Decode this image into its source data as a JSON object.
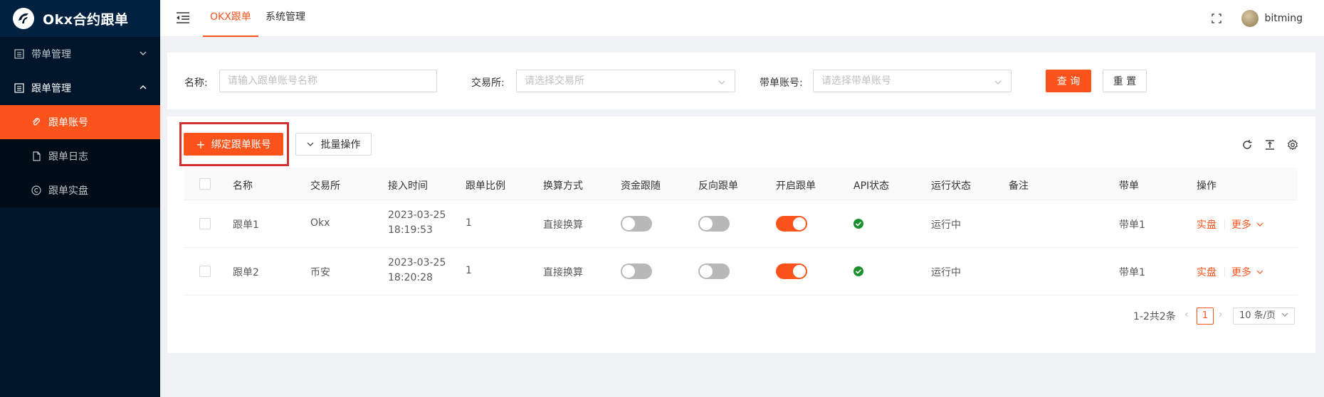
{
  "app": {
    "title": "Okx合约跟单"
  },
  "sidebar": {
    "groups": [
      {
        "label": "带单管理",
        "icon": "list-icon",
        "open": false
      },
      {
        "label": "跟单管理",
        "icon": "list-icon",
        "open": true
      }
    ],
    "items": [
      {
        "label": "跟单账号",
        "icon": "link-icon",
        "active": true
      },
      {
        "label": "跟单日志",
        "icon": "file-icon",
        "active": false
      },
      {
        "label": "跟单实盘",
        "icon": "copyright-icon",
        "active": false
      }
    ]
  },
  "header": {
    "tabs": [
      {
        "label": "OKX跟单",
        "active": true
      },
      {
        "label": "系统管理",
        "active": false
      }
    ],
    "username": "bitming"
  },
  "search": {
    "name_label": "名称:",
    "name_placeholder": "请输入跟单账号名称",
    "exchange_label": "交易所:",
    "exchange_placeholder": "请选择交易所",
    "lead_label": "带单账号:",
    "lead_placeholder": "请选择带单账号",
    "query_label": "查 询",
    "reset_label": "重 置"
  },
  "toolbar": {
    "bind_label": "绑定跟单账号",
    "batch_label": "批量操作"
  },
  "table": {
    "columns": [
      "名称",
      "交易所",
      "接入时间",
      "跟单比例",
      "换算方式",
      "资金跟随",
      "反向跟单",
      "开启跟单",
      "API状态",
      "运行状态",
      "备注",
      "带单",
      "操作"
    ],
    "rows": [
      {
        "name": "跟单1",
        "exchange": "Okx",
        "date": "2023-03-25",
        "time": "18:19:53",
        "ratio": "1",
        "method": "直接换算",
        "fund_follow": false,
        "reverse": false,
        "enabled": true,
        "api_ok": true,
        "status": "运行中",
        "remark": "",
        "lead": "带单1",
        "action1": "实盘",
        "action2": "更多"
      },
      {
        "name": "跟单2",
        "exchange": "币安",
        "date": "2023-03-25",
        "time": "18:20:28",
        "ratio": "1",
        "method": "直接换算",
        "fund_follow": false,
        "reverse": false,
        "enabled": true,
        "api_ok": true,
        "status": "运行中",
        "remark": "",
        "lead": "带单1",
        "action1": "实盘",
        "action2": "更多"
      }
    ]
  },
  "pagination": {
    "total_text": "1-2共2条",
    "current_page": "1",
    "page_size": "10 条/页"
  },
  "colors": {
    "accent": "#fa541c",
    "sidebar_bg": "#001529",
    "success": "#1a8f2e",
    "highlight": "#d32f2f"
  }
}
